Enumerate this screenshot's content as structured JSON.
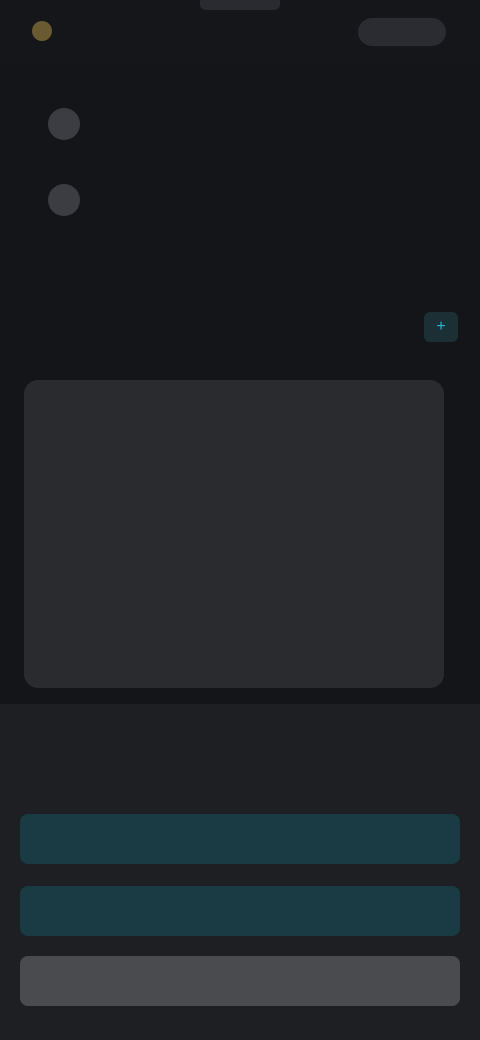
{
  "topbar": {
    "logo_text": "",
    "right_action": ""
  },
  "menu": {
    "items": [
      {
        "label": "",
        "icon": "circle-icon"
      },
      {
        "label": "",
        "icon": "circle-icon"
      }
    ]
  },
  "section": {
    "title": "",
    "action_icon": "plus-icon"
  },
  "card": {
    "placeholder": ""
  },
  "sheet": {
    "title": "",
    "buttons": [
      {
        "label": "",
        "style": "primary"
      },
      {
        "label": "",
        "style": "primary"
      },
      {
        "label": "",
        "style": "secondary"
      }
    ]
  },
  "colors": {
    "background": "#141518",
    "accent": "#1fa7c7",
    "accent_bg": "#1a3a44",
    "card": "#2a2b2f",
    "sheet": "#1e1f23"
  }
}
